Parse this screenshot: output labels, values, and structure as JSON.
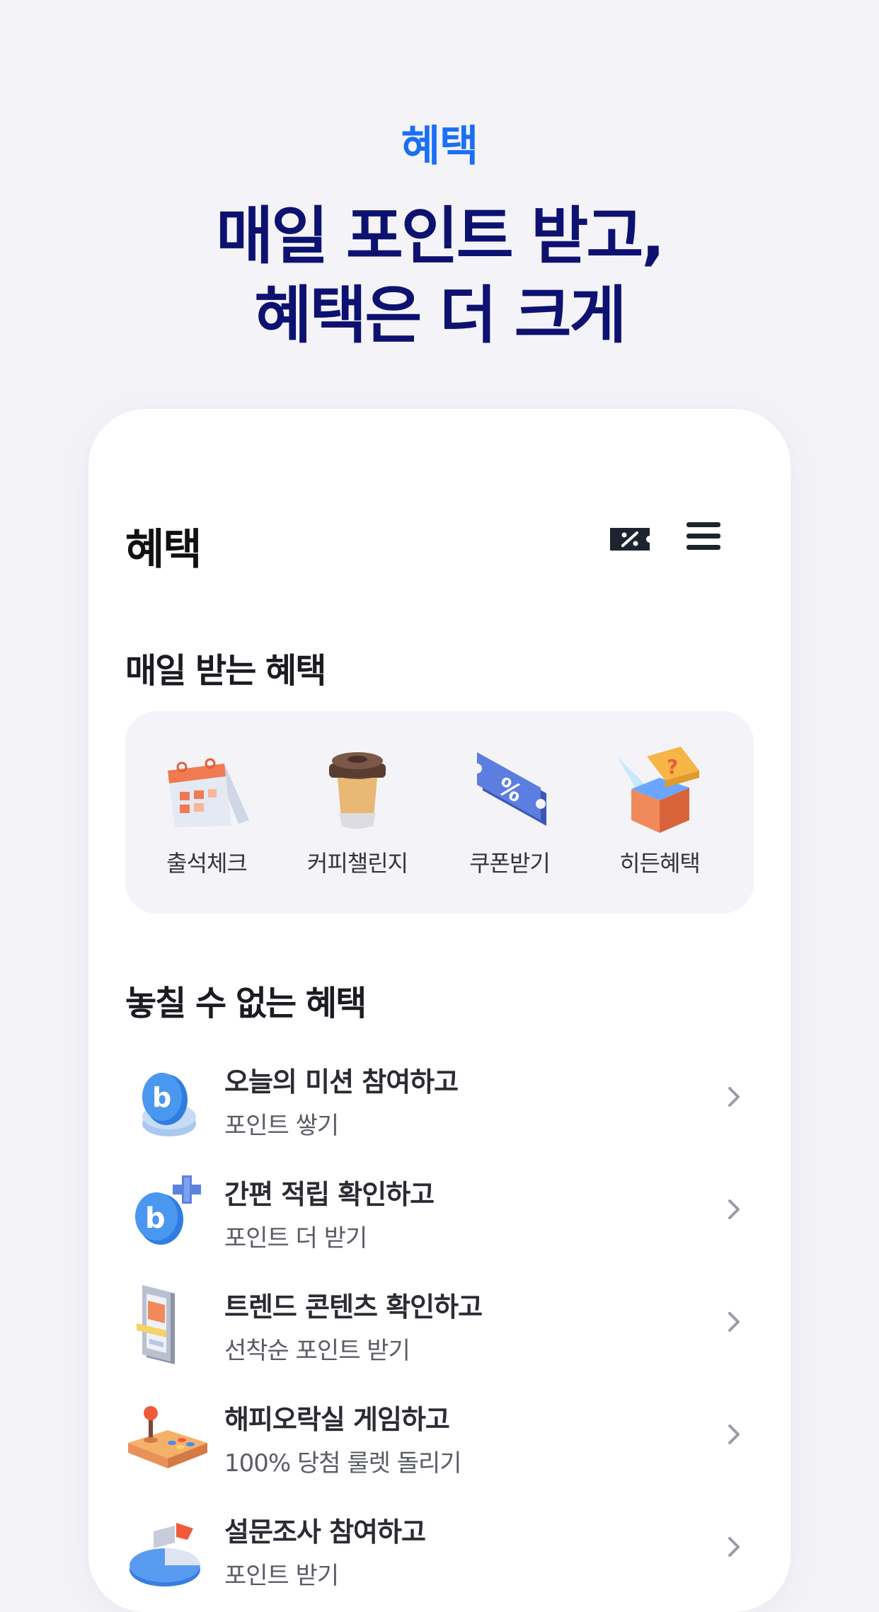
{
  "promo": {
    "tag": "혜택",
    "headline_line1": "매일 포인트 받고,",
    "headline_line2": "혜택은 더 크게"
  },
  "app": {
    "title": "혜택",
    "header_icons": [
      "coupon-icon",
      "menu-icon"
    ]
  },
  "daily": {
    "section_title": "매일 받는 혜택",
    "items": [
      {
        "label": "출석체크",
        "icon": "calendar-icon"
      },
      {
        "label": "커피챌린지",
        "icon": "coffee-cup-icon"
      },
      {
        "label": "쿠폰받기",
        "icon": "coupon-ticket-icon"
      },
      {
        "label": "히든혜택",
        "icon": "mystery-box-icon"
      }
    ]
  },
  "benefits": {
    "section_title": "놓칠 수 없는 혜택",
    "items": [
      {
        "title": "오늘의 미션 참여하고",
        "subtitle": "포인트 쌓기",
        "icon": "coin-stack-icon"
      },
      {
        "title": "간편 적립 확인하고",
        "subtitle": "포인트 더 받기",
        "icon": "coin-plus-icon"
      },
      {
        "title": "트렌드 콘텐츠 확인하고",
        "subtitle": "선착순 포인트 받기",
        "icon": "phone-content-icon"
      },
      {
        "title": "해피오락실 게임하고",
        "subtitle": "100% 당첨 룰렛 돌리기",
        "icon": "arcade-joystick-icon"
      },
      {
        "title": "설문조사 참여하고",
        "subtitle": "포인트 받기",
        "icon": "pie-chart-icon"
      }
    ]
  },
  "colors": {
    "accent": "#1a6ff5",
    "headline": "#0d1270",
    "background": "#f4f4f8"
  }
}
